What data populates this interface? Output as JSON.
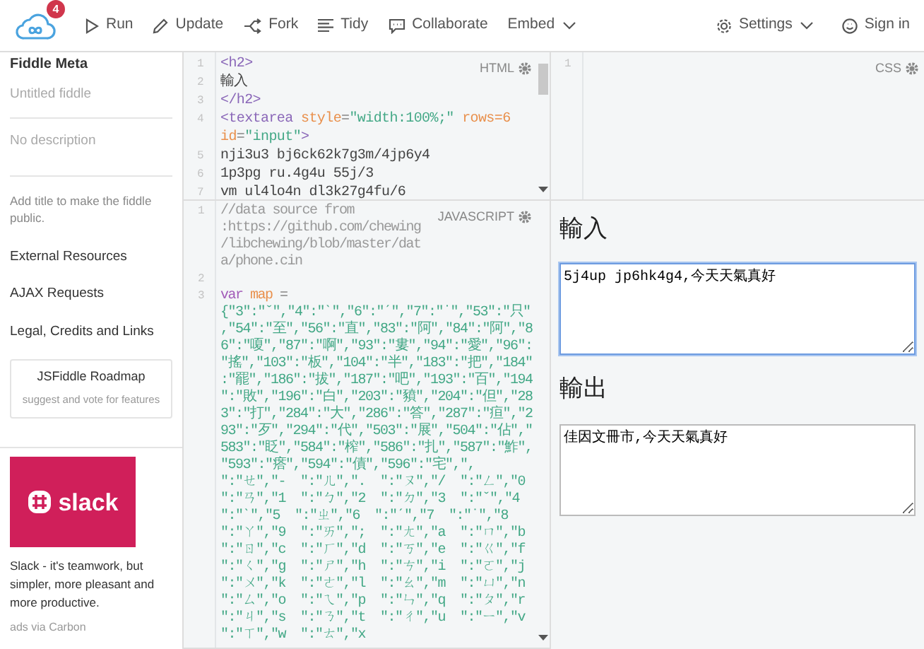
{
  "navbar": {
    "notification_count": "4",
    "actions": [
      {
        "label": "Run"
      },
      {
        "label": "Update"
      },
      {
        "label": "Fork"
      },
      {
        "label": "Tidy"
      },
      {
        "label": "Collaborate"
      },
      {
        "label": "Embed"
      }
    ],
    "right_actions": [
      {
        "label": "Settings"
      },
      {
        "label": "Sign in"
      }
    ]
  },
  "sidebar": {
    "title": "Fiddle Meta",
    "title_field": {
      "placeholder": "Untitled fiddle"
    },
    "description_field": {
      "placeholder": "No description"
    },
    "note": "Add title to make the fiddle public.",
    "links": [
      "External Resources",
      "AJAX Requests",
      "Legal, Credits and Links"
    ],
    "roadmap": {
      "title": "JSFiddle Roadmap",
      "subtitle": "suggest and vote for features"
    },
    "ad": {
      "logo_text": "slack",
      "text": "Slack - it's teamwork, but simpler, more pleasant and more productive.",
      "via": "ads via Carbon"
    }
  },
  "html_panel": {
    "label": "HTML",
    "lines": [
      {
        "number": "1",
        "tokens": [
          {
            "kind": "tag",
            "text": "<h2>"
          }
        ]
      },
      {
        "number": "2",
        "tokens": [
          {
            "kind": "text",
            "text": "輸入"
          }
        ]
      },
      {
        "number": "3",
        "tokens": [
          {
            "kind": "tag",
            "text": "</h2>"
          }
        ]
      },
      {
        "number": "4",
        "tokens": [
          {
            "kind": "tag",
            "text": "<textarea "
          },
          {
            "kind": "attribute",
            "text": "style"
          },
          {
            "kind": "operator",
            "text": "="
          },
          {
            "kind": "string",
            "text": "\"width:100%;\" "
          },
          {
            "kind": "attribute",
            "text": "rows=6 "
          },
          {
            "kind": "attribute",
            "text": "id"
          },
          {
            "kind": "operator",
            "text": "="
          },
          {
            "kind": "string",
            "text": "\"input\""
          },
          {
            "kind": "tag",
            "text": ">"
          }
        ]
      },
      {
        "number": "5",
        "tokens": [
          {
            "kind": "text",
            "text": "nji3u3 bj6ck62k7g3m/4jp6y4"
          }
        ]
      },
      {
        "number": "6",
        "tokens": [
          {
            "kind": "text",
            "text": "1p3pg ru.4g4u 55j/3"
          }
        ]
      },
      {
        "number": "7",
        "tokens": [
          {
            "kind": "text",
            "text": "vm ul4lo4n dl3k27g4fu/6"
          }
        ]
      }
    ]
  },
  "css_panel": {
    "label": "CSS",
    "lines": [
      {
        "number": "1"
      }
    ]
  },
  "js_panel": {
    "label": "JAVASCRIPT",
    "lines": [
      {
        "number": "1",
        "tokens": [
          {
            "kind": "comment",
            "text": "//data source from :https://github.com/chewing/libchewing/blob/master/data/phone.cin"
          }
        ]
      },
      {
        "number": "2"
      },
      {
        "number": "3",
        "tokens": [
          {
            "kind": "keyword",
            "text": "var "
          },
          {
            "kind": "variable",
            "text": "map "
          },
          {
            "kind": "operator",
            "text": "= "
          },
          {
            "kind": "string",
            "text": "{\"3\":\"ˇ\",\"4\":\"ˋ\",\"6\":\"ˊ\",\"7\":\"˙\",\"53\":\"只\",\"54\":\"至\",\"56\":\"直\",\"83\":\"阿\",\"84\":\"阿\",\"86\":\"嗄\",\"87\":\"啊\",\"93\":\"婁\",\"94\":\"愛\",\"96\":\"搖\",\"103\":\"板\",\"104\":\"半\",\"183\":\"把\",\"184\":\"罷\",\"186\":\"拔\",\"187\":\"吧\",\"193\":\"百\",\"194\":\"敗\",\"196\":\"白\",\"203\":\"豶\",\"204\":\"但\",\"283\":\"打\",\"284\":\"大\",\"286\":\"答\",\"287\":\"疸\",\"293\":\"歹\",\"294\":\"代\",\"503\":\"展\",\"504\":\"佔\",\"583\":\"眨\",\"584\":\"榨\",\"586\":\"扎\",\"587\":\"鮓\",\"593\":\"瘩\",\"594\":\"債\",\"596\":\"宅\",\",  \":\"ㄝ\",\"-  \":\"ㄦ\",\".  \":\"ㄡ\",\"/  \":\"ㄥ\",\"0  \":\"ㄢ\",\"1  \":\"ㄅ\",\"2  \":\"ㄉ\",\"3  \":\"ˇ\",\"4  \":\"ˋ\",\"5  \":\"ㄓ\",\"6  \":\"ˊ\",\"7  \":\"˙\",\"8  \":\"ㄚ\",\"9  \":\"ㄞ\",\";  \":\"ㄤ\",\"a  \":\"ㄇ\",\"b  \":\"ㄖ\",\"c  \":\"ㄏ\",\"d  \":\"ㄎ\",\"e  \":\"ㄍ\",\"f  \":\"ㄑ\",\"g  \":\"ㄕ\",\"h  \":\"ㄘ\",\"i  \":\"ㄛ\",\"j  \":\"ㄨ\",\"k  \":\"ㄜ\",\"l  \":\"ㄠ\",\"m  \":\"ㄩ\",\"n  \":\"ㄙ\",\"o  \":\"ㄟ\",\"p  \":\"ㄣ\",\"q  \":\"ㄆ\",\"r  \":\"ㄐ\",\"s  \":\"ㄋ\",\"t  \":\"ㄔ\",\"u  \":\"ㄧ\",\"v  \":\"ㄒ\",\"w  \":\"ㄊ\",\"x"
          }
        ]
      }
    ]
  },
  "result": {
    "input_heading": "輸入",
    "input": {
      "value": "5j4up jp6hk4g4,今天天氣真好",
      "focused": true
    },
    "output_heading": "輸出",
    "output": {
      "value": "佳因文冊市,今天天氣真好",
      "focused": false
    }
  }
}
